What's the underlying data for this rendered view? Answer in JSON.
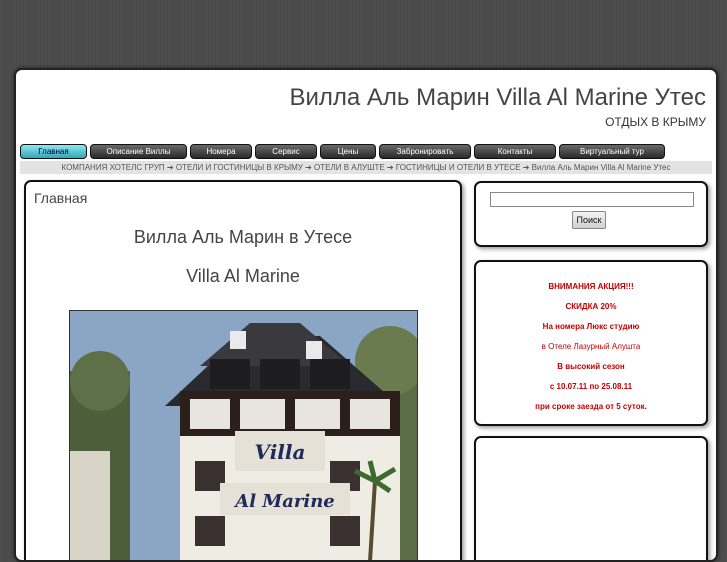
{
  "header": {
    "site_title": "Вилла Аль Марин Villa Al Marine Утес",
    "slogan": "ОТДЫХ В КРЫМУ"
  },
  "nav": {
    "items": [
      {
        "label": "Главная",
        "active": true
      },
      {
        "label": "Описание Виллы",
        "active": false
      },
      {
        "label": "Номера",
        "active": false
      },
      {
        "label": "Сервис",
        "active": false
      },
      {
        "label": "Цены",
        "active": false
      },
      {
        "label": "Забронировать",
        "active": false
      },
      {
        "label": "Контакты",
        "active": false
      },
      {
        "label": "Виртуальный тур",
        "active": false
      }
    ]
  },
  "breadcrumb": {
    "items": [
      "КОМПАНИЯ ХОТЕЛС ГРУП",
      "ОТЕЛИ И ГОСТИНИЦЫ В КРЫМУ",
      "ОТЕЛИ В АЛУШТЕ",
      "ГОСТИНИЦЫ И ОТЕЛИ В УТЕСЕ"
    ],
    "current": "Вилла Аль Марин Villa Al Marine Утес",
    "separator": "➔"
  },
  "article": {
    "heading": "Главная",
    "line1": "Вилла Аль Марин в Утесе",
    "line2": "Villa Al Marine",
    "photo_sign_top": "Villa",
    "photo_sign_bottom": "Al Marine"
  },
  "search": {
    "value": "",
    "button_label": "Поиск"
  },
  "promo": {
    "lines": [
      {
        "text": "ВНИМАНИЯ АКЦИЯ!!!",
        "bold": true
      },
      {
        "text": "СКИДКА 20%",
        "bold": true
      },
      {
        "text": "На номера Люкс студию",
        "bold": true
      },
      {
        "text": "в Отеле Лазурный Алушта",
        "bold": false
      },
      {
        "text": "В высокий сезон",
        "bold": true
      },
      {
        "text": "с 10.07.11 по 25.08.11",
        "bold": true
      },
      {
        "text": "при сроке заезда от 5 суток.",
        "bold": true
      }
    ]
  },
  "colors": {
    "background": "#4a4a4a",
    "accent_active_nav": "#2fa8bd",
    "promo_text": "#c00000"
  }
}
